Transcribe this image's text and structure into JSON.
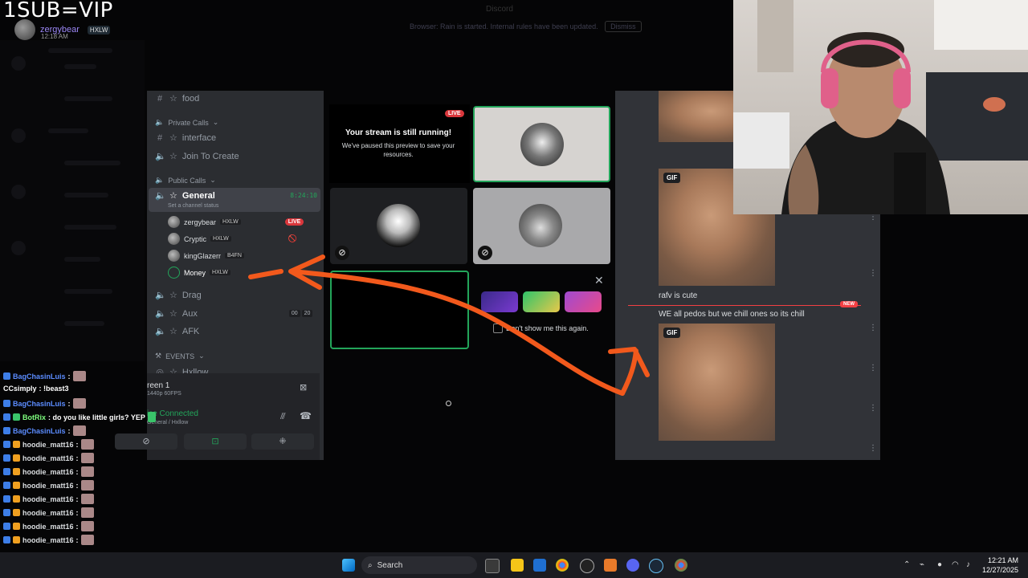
{
  "overlay": {
    "banner": "1SUB=VIP",
    "top_user": {
      "name": "zergybear",
      "tag": "HXLW",
      "time": "12:18 AM"
    },
    "dim_notice": "Browser: Rain is started. Internal rules have been updated.",
    "dim_notice_btn": "Dismiss",
    "dim_title": "Discord"
  },
  "sidebar": {
    "channels": [
      {
        "name": "food",
        "icon": "#"
      },
      {
        "name": "interface",
        "icon": "#"
      },
      {
        "name": "Join To Create",
        "icon": "🔊"
      }
    ],
    "cat_private": "Private Calls",
    "cat_public": "Public Calls",
    "general": {
      "name": "General",
      "time": "8:24:10",
      "status": "Set a channel status"
    },
    "voice_users": [
      {
        "name": "zergybear",
        "tag": "HXLW",
        "live": "LIVE"
      },
      {
        "name": "Cryptic",
        "tag": "HXLW"
      },
      {
        "name": "kingGlazerr",
        "tag": "B4FN"
      },
      {
        "name": "Money",
        "tag": "HXLW"
      }
    ],
    "other_voice": [
      {
        "name": "Drag"
      },
      {
        "name": "Aux",
        "c1": "00",
        "c2": "20"
      },
      {
        "name": "AFK"
      }
    ],
    "cat_events": "EVENTS",
    "hxllow": "Hxllow"
  },
  "panel": {
    "screen_title": "reen 1",
    "screen_sub": "1440p 60FPS",
    "voice_connected": "ice Connected",
    "voice_where": "General / Hxllow"
  },
  "stream": {
    "live": "LIVE",
    "paused_title": "Your stream is still running!",
    "paused_sub": "We've paused this preview to save your resources.",
    "promo_dont_show": "Don't show me this again."
  },
  "chat": {
    "gif_label": "GIF",
    "msg1": "rafv is cute",
    "new_badge": "NEW",
    "msg2": "WE all pedos but we chill ones so its chill"
  },
  "twitch_chat": [
    {
      "user": "BagChasinLuis",
      "color": "#5b8cff",
      "text": ":",
      "emote": true
    },
    {
      "user": "CCsimply",
      "color": "#ffffff",
      "text": ": !beast3",
      "emote": false
    },
    {
      "user": "BagChasinLuis",
      "color": "#5b8cff",
      "text": ":",
      "emote": true
    },
    {
      "user": "BotRix",
      "color": "#7fff7f",
      "text": ": do you like little girls? YEP",
      "emote": true
    },
    {
      "user": "BagChasinLuis",
      "color": "#5b8cff",
      "text": ":",
      "emote": true
    },
    {
      "user": "hoodie_matt16",
      "color": "#ffffff",
      "text": ":",
      "emote": true
    },
    {
      "user": "hoodie_matt16",
      "color": "#ffffff",
      "text": ":",
      "emote": true
    },
    {
      "user": "hoodie_matt16",
      "color": "#ffffff",
      "text": ":",
      "emote": true
    },
    {
      "user": "hoodie_matt16",
      "color": "#ffffff",
      "text": ":",
      "emote": true
    },
    {
      "user": "hoodie_matt16",
      "color": "#ffffff",
      "text": ":",
      "emote": true
    },
    {
      "user": "hoodie_matt16",
      "color": "#ffffff",
      "text": ":",
      "emote": true
    },
    {
      "user": "hoodie_matt16",
      "color": "#ffffff",
      "text": ":",
      "emote": true
    },
    {
      "user": "hoodie_matt16",
      "color": "#ffffff",
      "text": ":",
      "emote": true
    }
  ],
  "taskbar": {
    "search": "Search",
    "time": "12:21 AM",
    "date": "12/27/2025"
  },
  "colors": {
    "annotation_arrow": "#f2591c",
    "discord_green": "#23a55a",
    "live_red": "#da373c"
  }
}
